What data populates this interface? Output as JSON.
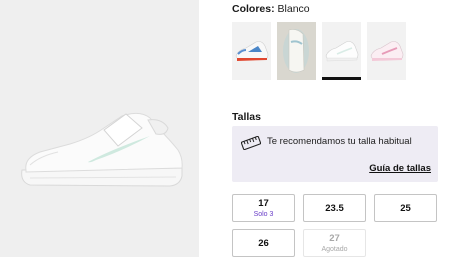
{
  "colors": {
    "label": "Colores:",
    "selected": "Blanco",
    "swatches": [
      {
        "name": "white-blue-red-variant",
        "selected": false
      },
      {
        "name": "white-iridescent-variant",
        "selected": false
      },
      {
        "name": "white-variant",
        "selected": true
      },
      {
        "name": "white-pink-variant",
        "selected": false
      }
    ]
  },
  "sizes": {
    "title": "Tallas",
    "recommendation": {
      "icon": "ruler-icon",
      "text": "Te recomendamos tu talla habitual",
      "guide_link": "Guía de tallas"
    },
    "options": [
      {
        "value": "17",
        "note": "Solo 3",
        "available": true
      },
      {
        "value": "23.5",
        "note": "",
        "available": true
      },
      {
        "value": "25",
        "note": "",
        "available": true
      },
      {
        "value": "26",
        "note": "",
        "available": true
      },
      {
        "value": "27",
        "note": "Agotado",
        "available": false
      }
    ]
  },
  "accent_color": "#6a3ec8"
}
